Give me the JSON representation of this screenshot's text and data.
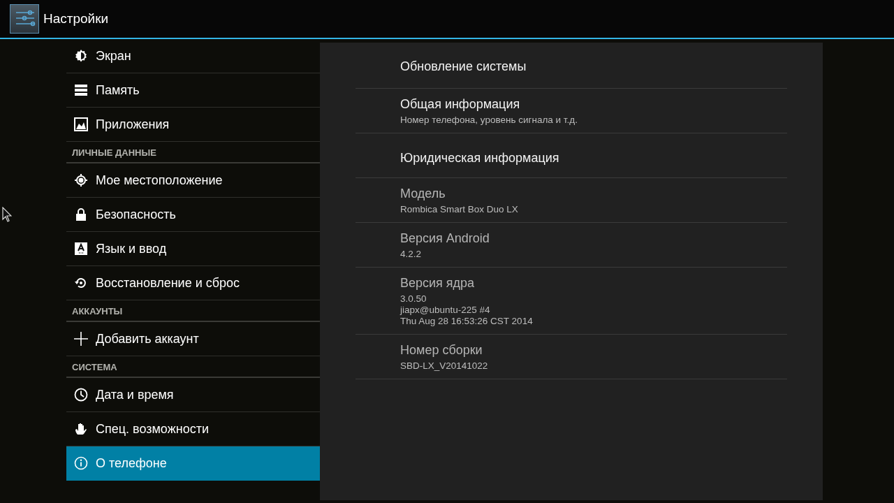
{
  "action_bar": {
    "title": "Настройки"
  },
  "sidebar": {
    "items": [
      {
        "kind": "item",
        "label": "Экран",
        "selected": false
      },
      {
        "kind": "item",
        "label": "Память",
        "selected": false
      },
      {
        "kind": "item",
        "label": "Приложения",
        "selected": false
      },
      {
        "kind": "header",
        "label": "ЛИЧНЫЕ ДАННЫЕ"
      },
      {
        "kind": "item",
        "label": "Мое местоположение",
        "selected": false
      },
      {
        "kind": "item",
        "label": "Безопасность",
        "selected": false
      },
      {
        "kind": "item",
        "label": "Язык и ввод",
        "selected": false
      },
      {
        "kind": "item",
        "label": "Восстановление и сброс",
        "selected": false
      },
      {
        "kind": "header",
        "label": "АККАУНТЫ"
      },
      {
        "kind": "item",
        "label": "Добавить аккаунт",
        "selected": false
      },
      {
        "kind": "header",
        "label": "СИСТЕМА"
      },
      {
        "kind": "item",
        "label": "Дата и время",
        "selected": false
      },
      {
        "kind": "item",
        "label": "Спец. возможности",
        "selected": false
      },
      {
        "kind": "item",
        "label": "О телефоне",
        "selected": true
      }
    ]
  },
  "details": {
    "items": [
      {
        "title": "Обновление системы",
        "disabled": false
      },
      {
        "title": "Общая информация",
        "summary": [
          "Номер телефона, уровень сигнала и т.д."
        ],
        "disabled": false
      },
      {
        "title": "Юридическая информация",
        "disabled": false
      },
      {
        "title": "Модель",
        "summary": [
          "Rombica Smart Box Duo LX"
        ],
        "disabled": true
      },
      {
        "title": "Версия Android",
        "summary": [
          "4.2.2"
        ],
        "disabled": true
      },
      {
        "title": "Версия ядра",
        "summary": [
          "3.0.50",
          "jiapx@ubuntu-225 #4",
          "Thu Aug 28 16:53:26 CST 2014"
        ],
        "disabled": true
      },
      {
        "title": "Номер сборки",
        "summary": [
          "SBD-LX_V20141022"
        ],
        "disabled": true
      }
    ]
  }
}
